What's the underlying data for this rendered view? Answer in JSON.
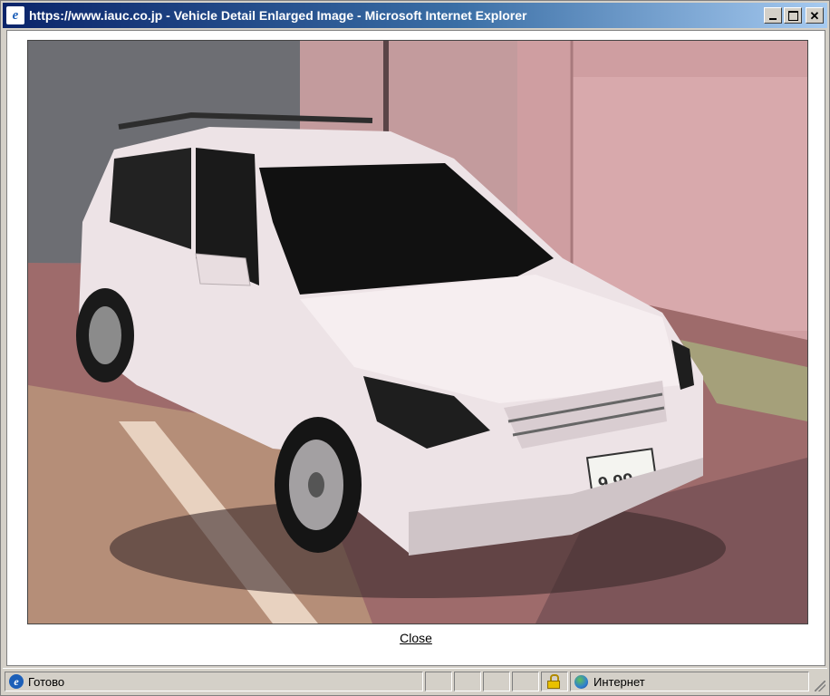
{
  "window": {
    "title": "https://www.iauc.co.jp - Vehicle Detail Enlarged Image - Microsoft Internet Explorer",
    "minimize_icon": "minimize-icon",
    "maximize_icon": "maximize-icon",
    "close_icon": "close-icon"
  },
  "content": {
    "close_label": "Close",
    "photo": {
      "subject": "white compact hatchback (parking garage)",
      "plate_text": "9 99"
    }
  },
  "statusbar": {
    "status_text": "Готово",
    "zone_text": "Интернет",
    "icons": [
      "ie-page-icon",
      "lock-icon",
      "globe-icon"
    ]
  },
  "colors": {
    "titlebar_start": "#0a246a",
    "titlebar_end": "#a6caf0",
    "chrome": "#d4d0c8"
  }
}
